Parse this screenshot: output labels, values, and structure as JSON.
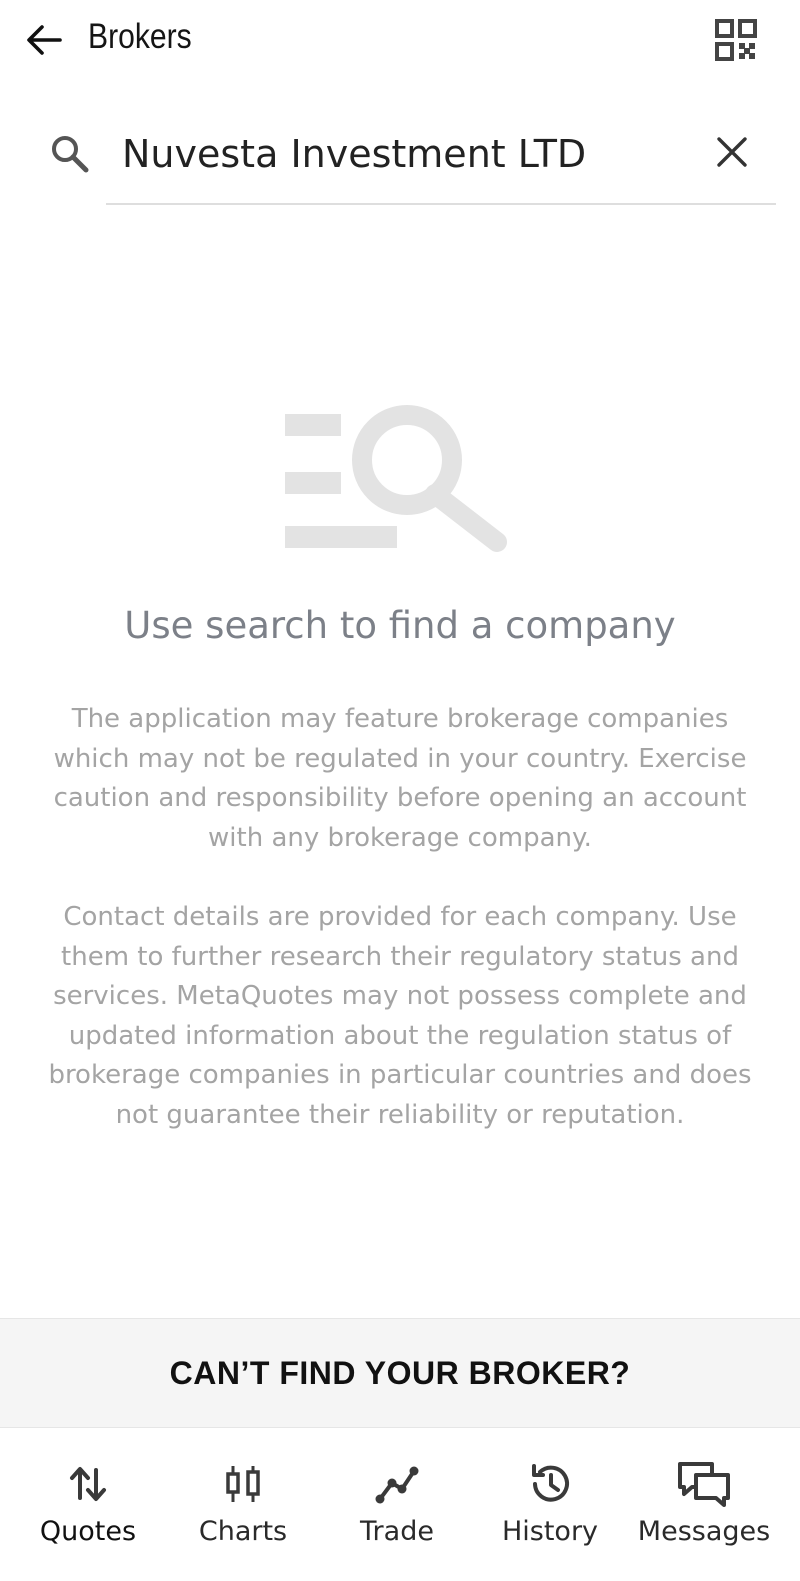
{
  "header": {
    "title": "Brokers",
    "back_icon": "arrow-left-icon",
    "qr_icon": "qr-code-icon"
  },
  "search": {
    "value": "Nuvesta Investment LTD",
    "search_icon": "search-icon",
    "clear_icon": "close-icon"
  },
  "empty_state": {
    "illustration": "search-list-illustration",
    "title": "Use search to find a company",
    "paragraph_1": "The application may feature brokerage companies which may not be regulated in your country. Exercise caution and responsibility before opening an account with any brokerage company.",
    "paragraph_2": "Contact details are provided for each company. Use them to further research their regulatory status and services. MetaQuotes may not possess complete and updated information about the regulation status of brokerage companies in particular countries and does not guarantee their reliability or reputation."
  },
  "cant_find": {
    "label": "CAN’T FIND YOUR BROKER?"
  },
  "bottom_nav": {
    "items": [
      {
        "label": "Quotes",
        "icon": "quotes-arrows-icon",
        "active": true
      },
      {
        "label": "Charts",
        "icon": "candlestick-icon",
        "active": false
      },
      {
        "label": "Trade",
        "icon": "trade-line-icon",
        "active": false
      },
      {
        "label": "History",
        "icon": "history-clock-icon",
        "active": false
      },
      {
        "label": "Messages",
        "icon": "messages-chat-icon",
        "active": false
      }
    ]
  },
  "colors": {
    "accent_caret": "#3b7ddd",
    "muted_text": "#a4a4a4",
    "title_text": "#7c8088",
    "illustration": "#e3e3e3"
  }
}
